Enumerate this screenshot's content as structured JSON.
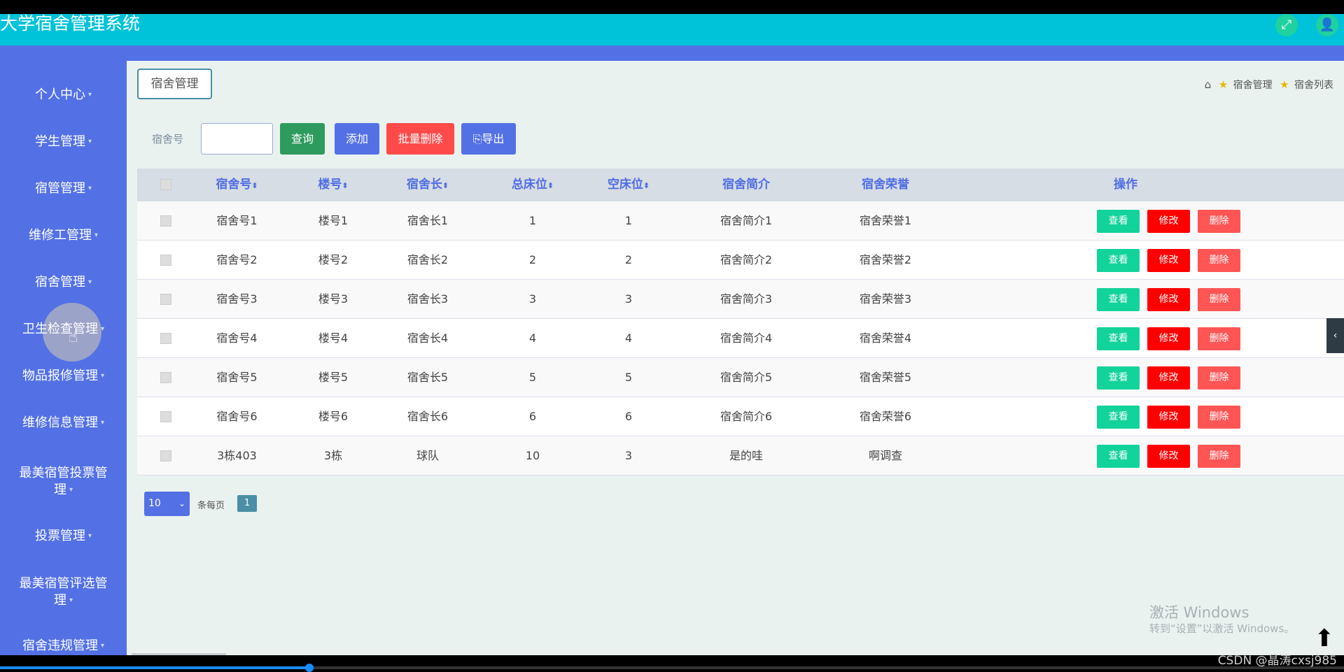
{
  "app": {
    "title": "大学宿舍管理系统"
  },
  "header": {
    "fullscreen_icon": "expand-icon",
    "user_icon": "user-icon"
  },
  "sidebar": {
    "items": [
      {
        "label": "个人中心"
      },
      {
        "label": "学生管理"
      },
      {
        "label": "宿管管理"
      },
      {
        "label": "维修工管理"
      },
      {
        "label": "宿舍管理"
      },
      {
        "label": "卫生检查管理"
      },
      {
        "label": "物品报修管理"
      },
      {
        "label": "维修信息管理"
      },
      {
        "label": "最美宿管投票管",
        "label2": "理"
      },
      {
        "label": "投票管理"
      },
      {
        "label": "最美宿管评选管",
        "label2": "理"
      },
      {
        "label": "宿舍违规管理"
      }
    ]
  },
  "page": {
    "tag": "宿舍管理",
    "breadcrumb": [
      "宿舍管理",
      "宿舍列表"
    ]
  },
  "search": {
    "label": "宿舍号",
    "value": "",
    "query_label": "查询",
    "add_label": "添加",
    "batch_delete_label": "批量删除",
    "export_label": "导出"
  },
  "table": {
    "headers": {
      "no": "宿舍号",
      "building": "楼号",
      "leader": "宿舍长",
      "total_beds": "总床位",
      "empty_beds": "空床位",
      "intro": "宿舍简介",
      "honor": "宿舍荣誉",
      "ops": "操作"
    },
    "rows": [
      {
        "no": "宿舍号1",
        "building": "楼号1",
        "leader": "宿舍长1",
        "total_beds": "1",
        "empty_beds": "1",
        "intro": "宿舍简介1",
        "honor": "宿舍荣誉1"
      },
      {
        "no": "宿舍号2",
        "building": "楼号2",
        "leader": "宿舍长2",
        "total_beds": "2",
        "empty_beds": "2",
        "intro": "宿舍简介2",
        "honor": "宿舍荣誉2"
      },
      {
        "no": "宿舍号3",
        "building": "楼号3",
        "leader": "宿舍长3",
        "total_beds": "3",
        "empty_beds": "3",
        "intro": "宿舍简介3",
        "honor": "宿舍荣誉3"
      },
      {
        "no": "宿舍号4",
        "building": "楼号4",
        "leader": "宿舍长4",
        "total_beds": "4",
        "empty_beds": "4",
        "intro": "宿舍简介4",
        "honor": "宿舍荣誉4"
      },
      {
        "no": "宿舍号5",
        "building": "楼号5",
        "leader": "宿舍长5",
        "total_beds": "5",
        "empty_beds": "5",
        "intro": "宿舍简介5",
        "honor": "宿舍荣誉5"
      },
      {
        "no": "宿舍号6",
        "building": "楼号6",
        "leader": "宿舍长6",
        "total_beds": "6",
        "empty_beds": "6",
        "intro": "宿舍简介6",
        "honor": "宿舍荣誉6"
      },
      {
        "no": "3栋403",
        "building": "3栋",
        "leader": "球队",
        "total_beds": "10",
        "empty_beds": "3",
        "intro": "是的哇",
        "honor": "啊调查"
      }
    ],
    "actions": {
      "view": "查看",
      "edit": "修改",
      "delete": "删除"
    }
  },
  "pagination": {
    "page_size": "10",
    "per_page_label": "条每页",
    "current_page": "1"
  },
  "overlay": {
    "watermark_title": "激活 Windows",
    "watermark_sub": "转到“设置”以激活 Windows。",
    "csdn": "CSDN @晶涛cxsj985",
    "video_progress": 0.23
  },
  "colors": {
    "header": "#00c2d9",
    "sidebar": "#5371e5",
    "view_button": "#12d39a",
    "edit_button": "#ff0000",
    "delete_button": "#ff5555"
  }
}
